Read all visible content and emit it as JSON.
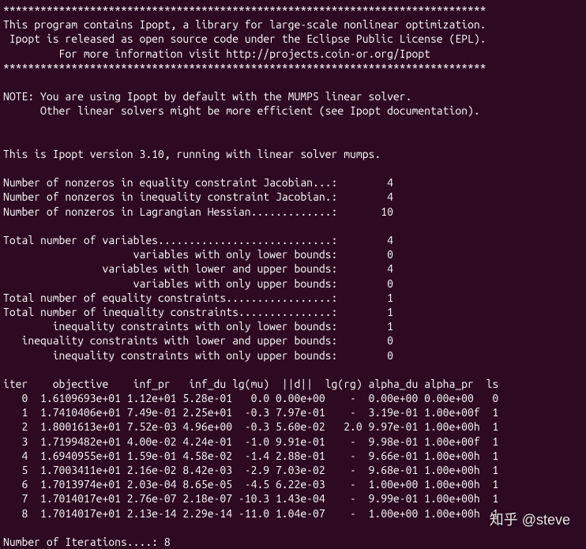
{
  "lines": {
    "header_stars": "******************************************************************************",
    "header_line1": "This program contains Ipopt, a library for large-scale nonlinear optimization.",
    "header_line2": " Ipopt is released as open source code under the Eclipse Public License (EPL).",
    "header_line3": "         For more information visit http://projects.coin-or.org/Ipopt",
    "header_stars2": "******************************************************************************",
    "blank": "",
    "note_line1": "NOTE: You are using Ipopt by default with the MUMPS linear solver.",
    "note_line2": "      Other linear solvers might be more efficient (see Ipopt documentation).",
    "version_line": "This is Ipopt version 3.10, running with linear solver mumps.",
    "nnz_eq_jac": "Number of nonzeros in equality constraint Jacobian...:        4",
    "nnz_ineq_jac": "Number of nonzeros in inequality constraint Jacobian.:        4",
    "nnz_lag_hess": "Number of nonzeros in Lagrangian Hessian.............:       10",
    "total_vars": "Total number of variables............................:        4",
    "vars_lower": "                     variables with only lower bounds:        0",
    "vars_both": "                variables with lower and upper bounds:        4",
    "vars_upper": "                     variables with only upper bounds:        0",
    "total_eq": "Total number of equality constraints.................:        1",
    "total_ineq": "Total number of inequality constraints...............:        1",
    "ineq_lower": "        inequality constraints with only lower bounds:        1",
    "ineq_both": "   inequality constraints with lower and upper bounds:        0",
    "ineq_upper": "        inequality constraints with only upper bounds:        0",
    "iter_header": "iter    objective    inf_pr   inf_du lg(mu)  ||d||  lg(rg) alpha_du alpha_pr  ls",
    "iter_0": "   0  1.6109693e+01 1.12e+01 5.28e-01   0.0 0.00e+00    -  0.00e+00 0.00e+00   0",
    "iter_1": "   1  1.7410406e+01 7.49e-01 2.25e+01  -0.3 7.97e-01    -  3.19e-01 1.00e+00f  1",
    "iter_2": "   2  1.8001613e+01 7.52e-03 4.96e+00  -0.3 5.60e-02   2.0 9.97e-01 1.00e+00h  1",
    "iter_3": "   3  1.7199482e+01 4.00e-02 4.24e-01  -1.0 9.91e-01    -  9.98e-01 1.00e+00f  1",
    "iter_4": "   4  1.6940955e+01 1.59e-01 4.58e-02  -1.4 2.88e-01    -  9.66e-01 1.00e+00h  1",
    "iter_5": "   5  1.7003411e+01 2.16e-02 8.42e-03  -2.9 7.03e-02    -  9.68e-01 1.00e+00h  1",
    "iter_6": "   6  1.7013974e+01 2.03e-04 8.65e-05  -4.5 6.22e-03    -  1.00e+00 1.00e+00h  1",
    "iter_7": "   7  1.7014017e+01 2.76e-07 2.18e-07 -10.3 1.43e-04    -  9.99e-01 1.00e+00h  1",
    "iter_8": "   8  1.7014017e+01 2.13e-14 2.29e-14 -11.0 1.04e-07    -  1.00e+00 1.00e+00h  1",
    "num_iters": "Number of Iterations....: 8"
  },
  "watermark": "知乎 @steve"
}
